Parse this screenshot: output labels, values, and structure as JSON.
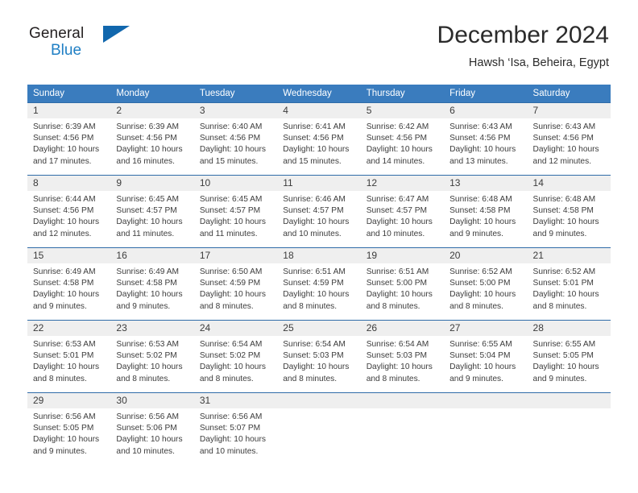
{
  "brand": {
    "name_part1": "General",
    "name_part2": "Blue",
    "flag_icon": "triangle-flag-icon"
  },
  "header": {
    "title": "December 2024",
    "subtitle": "Hawsh ‘Isa, Beheira, Egypt"
  },
  "colors": {
    "header_blue": "#3a7cbe",
    "row_border_blue": "#2f6ca8",
    "brand_blue": "#1f7fc4",
    "daynum_band": "#efefef",
    "text": "#3c3c3c"
  },
  "weekday_headers": [
    "Sunday",
    "Monday",
    "Tuesday",
    "Wednesday",
    "Thursday",
    "Friday",
    "Saturday"
  ],
  "weeks": [
    [
      {
        "day": "1",
        "sunrise": "Sunrise: 6:39 AM",
        "sunset": "Sunset: 4:56 PM",
        "daylight": "Daylight: 10 hours and 17 minutes."
      },
      {
        "day": "2",
        "sunrise": "Sunrise: 6:39 AM",
        "sunset": "Sunset: 4:56 PM",
        "daylight": "Daylight: 10 hours and 16 minutes."
      },
      {
        "day": "3",
        "sunrise": "Sunrise: 6:40 AM",
        "sunset": "Sunset: 4:56 PM",
        "daylight": "Daylight: 10 hours and 15 minutes."
      },
      {
        "day": "4",
        "sunrise": "Sunrise: 6:41 AM",
        "sunset": "Sunset: 4:56 PM",
        "daylight": "Daylight: 10 hours and 15 minutes."
      },
      {
        "day": "5",
        "sunrise": "Sunrise: 6:42 AM",
        "sunset": "Sunset: 4:56 PM",
        "daylight": "Daylight: 10 hours and 14 minutes."
      },
      {
        "day": "6",
        "sunrise": "Sunrise: 6:43 AM",
        "sunset": "Sunset: 4:56 PM",
        "daylight": "Daylight: 10 hours and 13 minutes."
      },
      {
        "day": "7",
        "sunrise": "Sunrise: 6:43 AM",
        "sunset": "Sunset: 4:56 PM",
        "daylight": "Daylight: 10 hours and 12 minutes."
      }
    ],
    [
      {
        "day": "8",
        "sunrise": "Sunrise: 6:44 AM",
        "sunset": "Sunset: 4:56 PM",
        "daylight": "Daylight: 10 hours and 12 minutes."
      },
      {
        "day": "9",
        "sunrise": "Sunrise: 6:45 AM",
        "sunset": "Sunset: 4:57 PM",
        "daylight": "Daylight: 10 hours and 11 minutes."
      },
      {
        "day": "10",
        "sunrise": "Sunrise: 6:45 AM",
        "sunset": "Sunset: 4:57 PM",
        "daylight": "Daylight: 10 hours and 11 minutes."
      },
      {
        "day": "11",
        "sunrise": "Sunrise: 6:46 AM",
        "sunset": "Sunset: 4:57 PM",
        "daylight": "Daylight: 10 hours and 10 minutes."
      },
      {
        "day": "12",
        "sunrise": "Sunrise: 6:47 AM",
        "sunset": "Sunset: 4:57 PM",
        "daylight": "Daylight: 10 hours and 10 minutes."
      },
      {
        "day": "13",
        "sunrise": "Sunrise: 6:48 AM",
        "sunset": "Sunset: 4:58 PM",
        "daylight": "Daylight: 10 hours and 9 minutes."
      },
      {
        "day": "14",
        "sunrise": "Sunrise: 6:48 AM",
        "sunset": "Sunset: 4:58 PM",
        "daylight": "Daylight: 10 hours and 9 minutes."
      }
    ],
    [
      {
        "day": "15",
        "sunrise": "Sunrise: 6:49 AM",
        "sunset": "Sunset: 4:58 PM",
        "daylight": "Daylight: 10 hours and 9 minutes."
      },
      {
        "day": "16",
        "sunrise": "Sunrise: 6:49 AM",
        "sunset": "Sunset: 4:58 PM",
        "daylight": "Daylight: 10 hours and 9 minutes."
      },
      {
        "day": "17",
        "sunrise": "Sunrise: 6:50 AM",
        "sunset": "Sunset: 4:59 PM",
        "daylight": "Daylight: 10 hours and 8 minutes."
      },
      {
        "day": "18",
        "sunrise": "Sunrise: 6:51 AM",
        "sunset": "Sunset: 4:59 PM",
        "daylight": "Daylight: 10 hours and 8 minutes."
      },
      {
        "day": "19",
        "sunrise": "Sunrise: 6:51 AM",
        "sunset": "Sunset: 5:00 PM",
        "daylight": "Daylight: 10 hours and 8 minutes."
      },
      {
        "day": "20",
        "sunrise": "Sunrise: 6:52 AM",
        "sunset": "Sunset: 5:00 PM",
        "daylight": "Daylight: 10 hours and 8 minutes."
      },
      {
        "day": "21",
        "sunrise": "Sunrise: 6:52 AM",
        "sunset": "Sunset: 5:01 PM",
        "daylight": "Daylight: 10 hours and 8 minutes."
      }
    ],
    [
      {
        "day": "22",
        "sunrise": "Sunrise: 6:53 AM",
        "sunset": "Sunset: 5:01 PM",
        "daylight": "Daylight: 10 hours and 8 minutes."
      },
      {
        "day": "23",
        "sunrise": "Sunrise: 6:53 AM",
        "sunset": "Sunset: 5:02 PM",
        "daylight": "Daylight: 10 hours and 8 minutes."
      },
      {
        "day": "24",
        "sunrise": "Sunrise: 6:54 AM",
        "sunset": "Sunset: 5:02 PM",
        "daylight": "Daylight: 10 hours and 8 minutes."
      },
      {
        "day": "25",
        "sunrise": "Sunrise: 6:54 AM",
        "sunset": "Sunset: 5:03 PM",
        "daylight": "Daylight: 10 hours and 8 minutes."
      },
      {
        "day": "26",
        "sunrise": "Sunrise: 6:54 AM",
        "sunset": "Sunset: 5:03 PM",
        "daylight": "Daylight: 10 hours and 8 minutes."
      },
      {
        "day": "27",
        "sunrise": "Sunrise: 6:55 AM",
        "sunset": "Sunset: 5:04 PM",
        "daylight": "Daylight: 10 hours and 9 minutes."
      },
      {
        "day": "28",
        "sunrise": "Sunrise: 6:55 AM",
        "sunset": "Sunset: 5:05 PM",
        "daylight": "Daylight: 10 hours and 9 minutes."
      }
    ],
    [
      {
        "day": "29",
        "sunrise": "Sunrise: 6:56 AM",
        "sunset": "Sunset: 5:05 PM",
        "daylight": "Daylight: 10 hours and 9 minutes."
      },
      {
        "day": "30",
        "sunrise": "Sunrise: 6:56 AM",
        "sunset": "Sunset: 5:06 PM",
        "daylight": "Daylight: 10 hours and 10 minutes."
      },
      {
        "day": "31",
        "sunrise": "Sunrise: 6:56 AM",
        "sunset": "Sunset: 5:07 PM",
        "daylight": "Daylight: 10 hours and 10 minutes."
      },
      {
        "day": "",
        "sunrise": "",
        "sunset": "",
        "daylight": ""
      },
      {
        "day": "",
        "sunrise": "",
        "sunset": "",
        "daylight": ""
      },
      {
        "day": "",
        "sunrise": "",
        "sunset": "",
        "daylight": ""
      },
      {
        "day": "",
        "sunrise": "",
        "sunset": "",
        "daylight": ""
      }
    ]
  ]
}
